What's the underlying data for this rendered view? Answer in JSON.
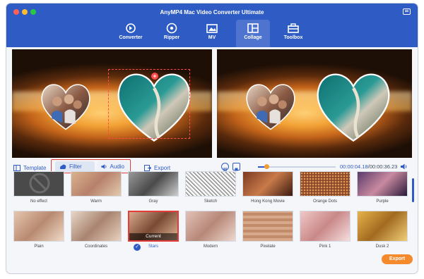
{
  "app": {
    "title": "AnyMP4 Mac Video Converter Ultimate"
  },
  "nav": {
    "items": [
      {
        "label": "Converter",
        "icon": "converter-icon"
      },
      {
        "label": "Ripper",
        "icon": "ripper-icon"
      },
      {
        "label": "MV",
        "icon": "mv-icon"
      },
      {
        "label": "Collage",
        "icon": "collage-icon",
        "active": true
      },
      {
        "label": "Toolbox",
        "icon": "toolbox-icon"
      }
    ]
  },
  "editor": {
    "template_label": "Template",
    "filter_label": "Filter",
    "audio_label": "Audio",
    "export_label": "Export"
  },
  "player": {
    "current_time": "00:00:04.18",
    "total_time": "/00:00:36.23",
    "progress": 0.11
  },
  "filters": {
    "row1": [
      {
        "label": "No effect"
      },
      {
        "label": "Warm"
      },
      {
        "label": "Gray"
      },
      {
        "label": "Sketch"
      },
      {
        "label": "Hong Kong Movie"
      },
      {
        "label": "Orange Dots"
      },
      {
        "label": "Purple"
      }
    ],
    "row2": [
      {
        "label": "Plain"
      },
      {
        "label": "Coordinates"
      },
      {
        "label": "Stars",
        "selected": true
      },
      {
        "label": "Modern"
      },
      {
        "label": "Pixelate"
      },
      {
        "label": "Pink 1"
      },
      {
        "label": "Dusk 2"
      }
    ],
    "current_tag": "Current"
  },
  "bottom": {
    "export_button": "Export"
  },
  "colors": {
    "brand_blue": "#2f5bc4",
    "accent_orange": "#f48a2c",
    "highlight_red": "#e43b3b"
  }
}
